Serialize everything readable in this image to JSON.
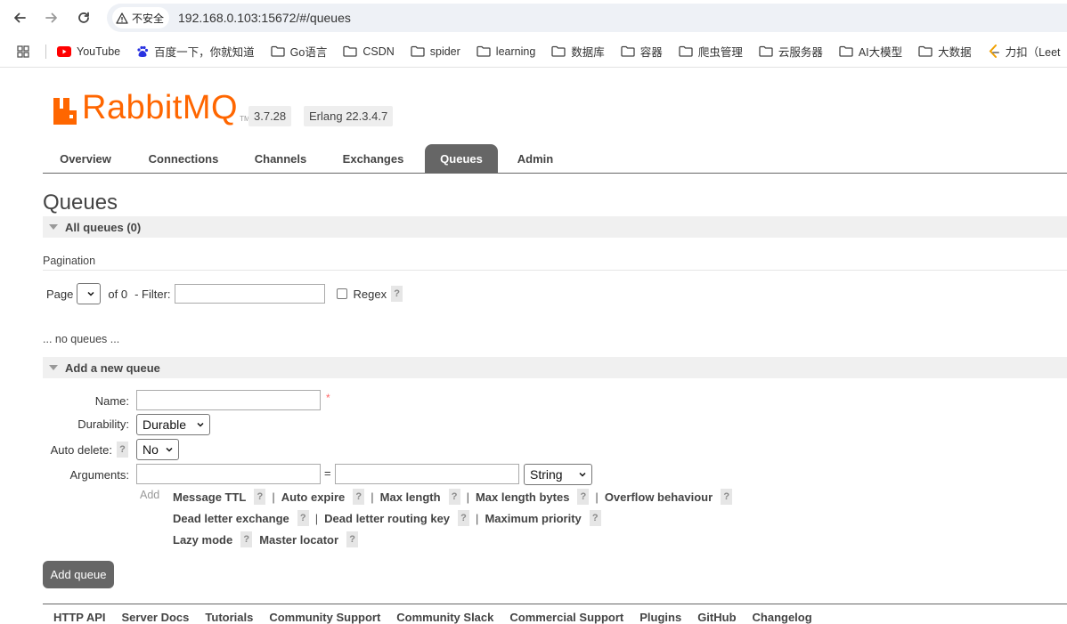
{
  "browser": {
    "security_label": "不安全",
    "url": "192.168.0.103:15672/#/queues",
    "bookmarks": [
      {
        "label": "YouTube",
        "icon": "youtube-icon"
      },
      {
        "label": "百度一下，你就知道",
        "icon": "baidu-icon"
      },
      {
        "label": "Go语言",
        "icon": "folder-icon"
      },
      {
        "label": "CSDN",
        "icon": "folder-icon"
      },
      {
        "label": "spider",
        "icon": "folder-icon"
      },
      {
        "label": "learning",
        "icon": "folder-icon"
      },
      {
        "label": "数据库",
        "icon": "folder-icon"
      },
      {
        "label": "容器",
        "icon": "folder-icon"
      },
      {
        "label": "爬虫管理",
        "icon": "folder-icon"
      },
      {
        "label": "云服务器",
        "icon": "folder-icon"
      },
      {
        "label": "AI大模型",
        "icon": "folder-icon"
      },
      {
        "label": "大数据",
        "icon": "folder-icon"
      },
      {
        "label": "力扣（Leet",
        "icon": "leetcode-icon"
      }
    ]
  },
  "header": {
    "logo_text": "RabbitMQ",
    "logo_tm": "TM",
    "version": "3.7.28",
    "erlang": "Erlang 22.3.4.7",
    "accent": "#ff6600"
  },
  "tabs": [
    {
      "label": "Overview"
    },
    {
      "label": "Connections"
    },
    {
      "label": "Channels"
    },
    {
      "label": "Exchanges"
    },
    {
      "label": "Queues",
      "active": true
    },
    {
      "label": "Admin"
    }
  ],
  "page": {
    "title": "Queues",
    "all_queues_label": "All queues (0)",
    "pagination_label": "Pagination",
    "page_label": "Page",
    "of_label": "of 0",
    "filter_label": "- Filter:",
    "filter_value": "",
    "regex_label": "Regex",
    "regex_checked": false,
    "help_mark": "?",
    "no_queues": "... no queues ..."
  },
  "add_queue": {
    "section_label": "Add a new queue",
    "name_label": "Name:",
    "name_value": "",
    "required_mark": "*",
    "durability_label": "Durability:",
    "durability_value": "Durable",
    "auto_delete_label": "Auto delete:",
    "auto_delete_value": "No",
    "arguments_label": "Arguments:",
    "equals": "=",
    "arg_type_value": "String",
    "add_label": "Add",
    "arg_links_row1": [
      "Message TTL",
      "Auto expire",
      "Max length",
      "Max length bytes",
      "Overflow behaviour"
    ],
    "arg_links_row2": [
      "Dead letter exchange",
      "Dead letter routing key",
      "Maximum priority"
    ],
    "arg_links_row3": [
      "Lazy mode",
      "Master locator"
    ],
    "separator": "|",
    "submit_label": "Add queue"
  },
  "footer": {
    "links": [
      "HTTP API",
      "Server Docs",
      "Tutorials",
      "Community Support",
      "Community Slack",
      "Commercial Support",
      "Plugins",
      "GitHub",
      "Changelog"
    ]
  }
}
